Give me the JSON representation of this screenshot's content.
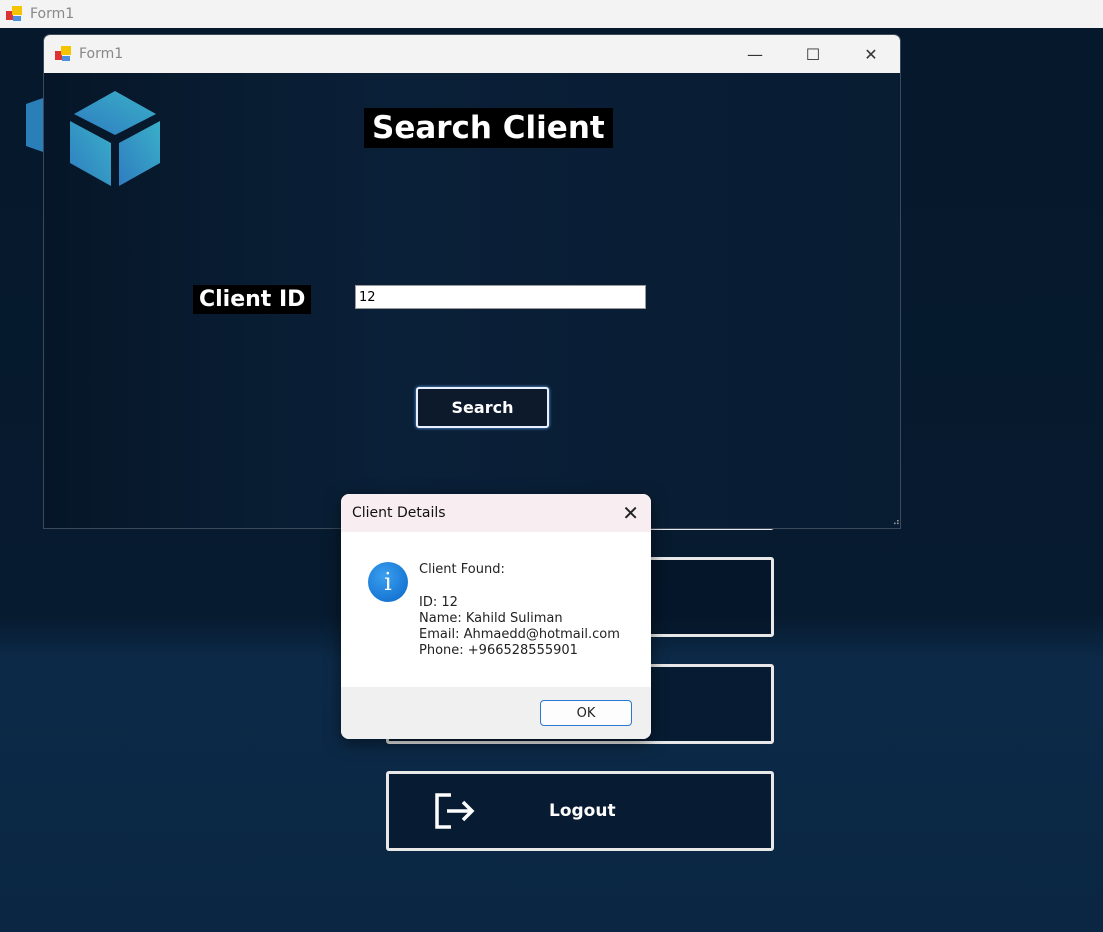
{
  "outer_window": {
    "title": "Form1"
  },
  "window": {
    "title": "Form1",
    "minimize": "—",
    "maximize": "☐",
    "close": "✕"
  },
  "form": {
    "heading": "Search Client",
    "client_id_label": "Client ID",
    "client_id_value": "12",
    "search_label": "Search"
  },
  "menu": {
    "logout_label": "Logout"
  },
  "dialog": {
    "title": "Client Details",
    "close": "✕",
    "icon": "info-icon",
    "message": "Client Found:\n\nID: 12\nName: Kahild Suliman\nEmail: Ahmaedd@hotmail.com\nPhone: +966528555901",
    "ok_label": "OK"
  },
  "colors": {
    "accent": "#2a78d0",
    "background": "#071a2e"
  }
}
